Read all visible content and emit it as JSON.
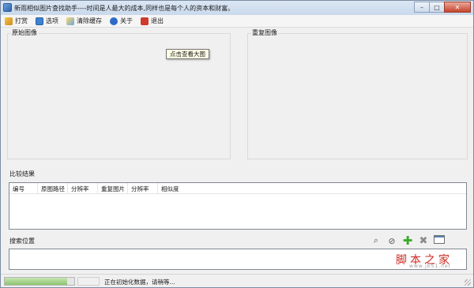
{
  "window": {
    "title": "新雨相似图片查找助手----时间是人最大的成本,同样也是每个人的资本和财富。",
    "minimize_label": "–",
    "maximize_label": "□",
    "close_label": "✕"
  },
  "menu": {
    "items": [
      {
        "label": "打赏",
        "icon": "gift-icon"
      },
      {
        "label": "选项",
        "icon": "options-icon"
      },
      {
        "label": "清除缓存",
        "icon": "broom-icon"
      },
      {
        "label": "关于",
        "icon": "info-icon"
      },
      {
        "label": "退出",
        "icon": "exit-icon"
      }
    ]
  },
  "panes": {
    "original_label": "原始图像",
    "duplicate_label": "重复图像",
    "tooltip": "点击查看大图"
  },
  "results": {
    "label": "比较结果",
    "columns": [
      "编号",
      "原图路径",
      "分辨率",
      "重复图片",
      "分辨率",
      "相似度"
    ],
    "rows": []
  },
  "search": {
    "label": "搜索位置",
    "tools": [
      "search-icon",
      "ban-icon",
      "add-icon",
      "delete-icon",
      "window-icon"
    ]
  },
  "watermark": {
    "text": "脚本之家",
    "url": "www.jb51.net"
  },
  "status": {
    "text": "正在初始化数据，请稍等...",
    "progress": 0.9
  },
  "colors": {
    "accent": "#3aaa2a",
    "watermark": "#cc2a22"
  }
}
